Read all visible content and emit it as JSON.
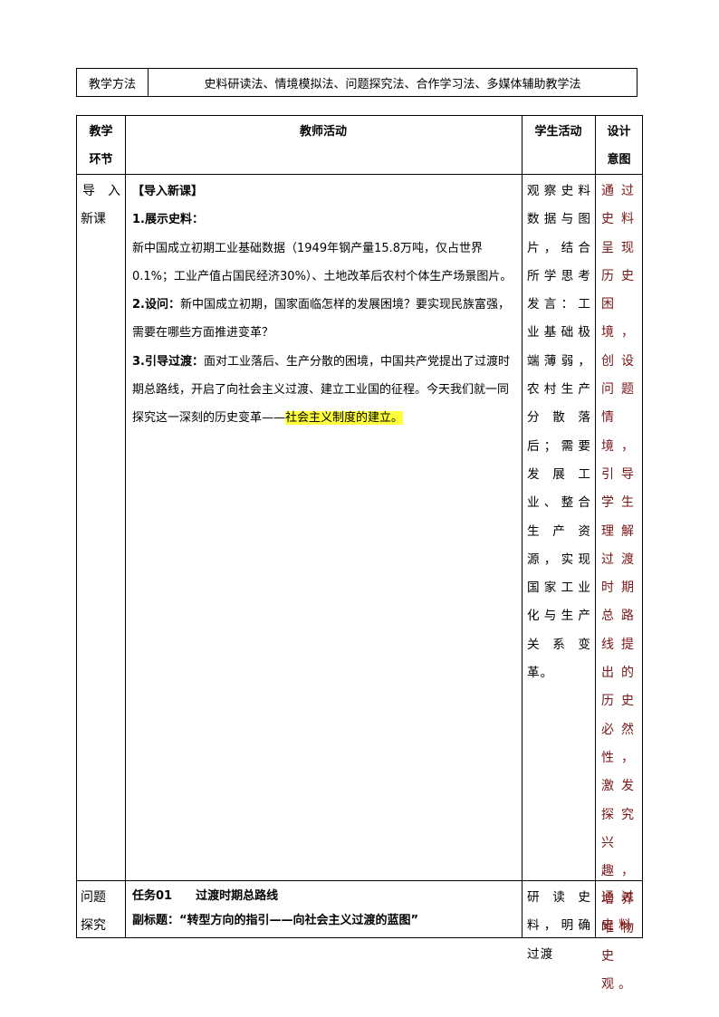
{
  "method": {
    "label": "教学方法",
    "value": "史料研读法、情境模拟法、问题探究法、合作学习法、多媒体辅助教学法"
  },
  "table": {
    "headers": {
      "col1_line1": "教学",
      "col1_line2": "环节",
      "col2": "教师活动",
      "col3": "学生活动",
      "col4_line1": "设计",
      "col4_line2": "意图"
    },
    "row1": {
      "stage_line1_a": "导",
      "stage_line1_b": "入",
      "stage_line2": "新课",
      "teacher": {
        "section_title": "【导入新课】",
        "step1_title": "1.展示史料：",
        "step1_text": "新中国成立初期工业基础数据（1949年钢产量15.8万吨，仅占世界0.1%；工业产值占国民经济30%）、土地改革后农村个体生产场景图片。",
        "step2_title": "2.设问：",
        "step2_text": "新中国成立初期，国家面临怎样的发展困境？要实现民族富强，需要在哪些方面推进变革？",
        "step3_title": "3.引导过渡：",
        "step3_text": "面对工业落后、生产分散的困境，中国共产党提出了过渡时期总路线，开启了向社会主义过渡、建立工业国的征程。今天我们就一同探究这一深刻的历史变革——",
        "step3_highlight": "社会主义制度的建立。"
      },
      "student": "观察史料数据与图片，结合所学思考发言：工业基础极端薄弱，农村生产分散落后；需要发展工业、整合生产资源，实现国家工业化与生产关系变革。",
      "intent": "通过史料呈现历史困境，创设问题情境，引导学生理解过渡时期总路线提出的历史必然性，激发探究兴趣，培养唯物史观。"
    },
    "row2": {
      "stage_line1": "问题",
      "stage_line2": "探究",
      "task": "任务01　　过渡时期总路线",
      "subtitle": "副标题：“转型方向的指引——向社会主义过渡的蓝图”",
      "student": "研读史料，明确过渡",
      "intent": "通过史料"
    }
  }
}
